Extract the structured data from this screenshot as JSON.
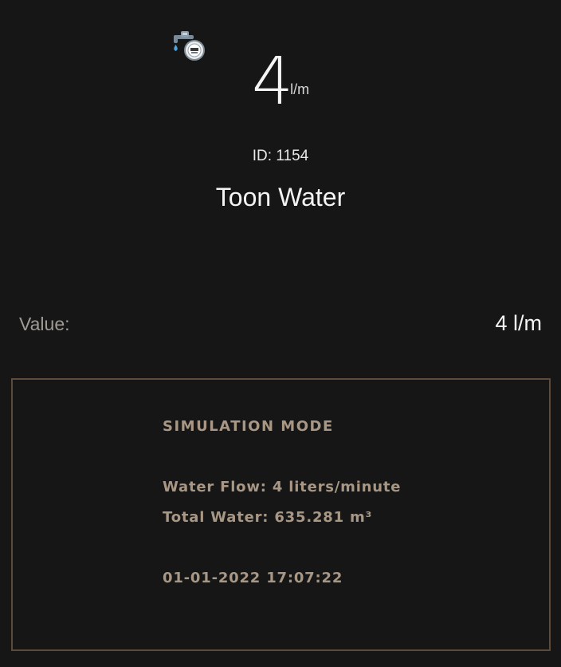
{
  "header": {
    "icon": "water-meter-icon",
    "value": "4",
    "unit": "l/m",
    "id_text": "ID: 1154",
    "name": "Toon Water"
  },
  "value_row": {
    "label": "Value:",
    "value": "4 l/m"
  },
  "simulation": {
    "title": "SIMULATION MODE",
    "water_flow": "Water Flow: 4 liters/minute",
    "total_water": "Total Water: 635.281 m³",
    "timestamp": "01-01-2022 17:07:22"
  },
  "colors": {
    "background": "#161616",
    "accent": "#a89784",
    "border": "#5c4a3a"
  }
}
